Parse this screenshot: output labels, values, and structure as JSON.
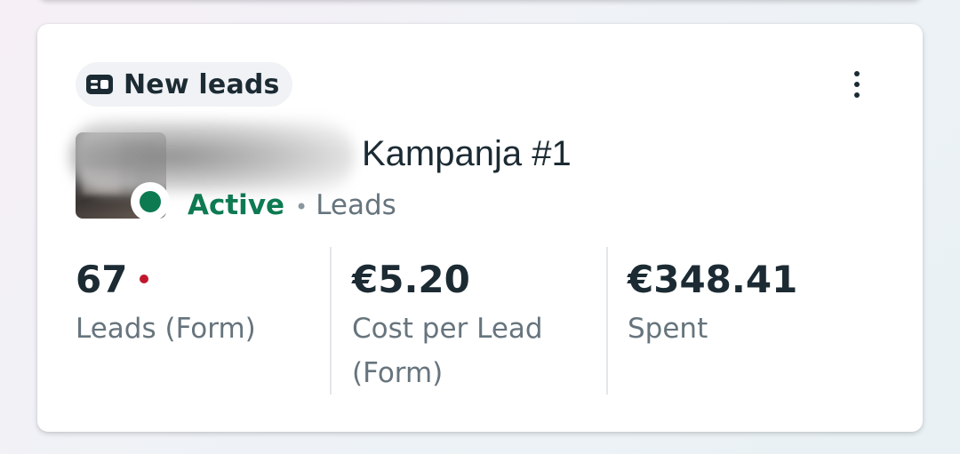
{
  "objective_chip": {
    "label": "New leads",
    "icon": "lead-form-icon"
  },
  "more_menu": {
    "icon": "more-vertical-icon"
  },
  "campaign": {
    "name": "Kampanja #1",
    "status": "Active",
    "status_color": "#0d7a52",
    "separator": "•",
    "objective": "Leads"
  },
  "metrics": [
    {
      "value": "67",
      "label": "Leads (Form)",
      "alert_color": "#c0172f"
    },
    {
      "value": "€5.20",
      "label": "Cost per Lead (Form)"
    },
    {
      "value": "€348.41",
      "label": "Spent"
    }
  ],
  "colors": {
    "text_primary": "#1c2b33",
    "text_secondary": "#66747d",
    "active_green": "#0d7a52",
    "alert_red": "#c0172f"
  }
}
